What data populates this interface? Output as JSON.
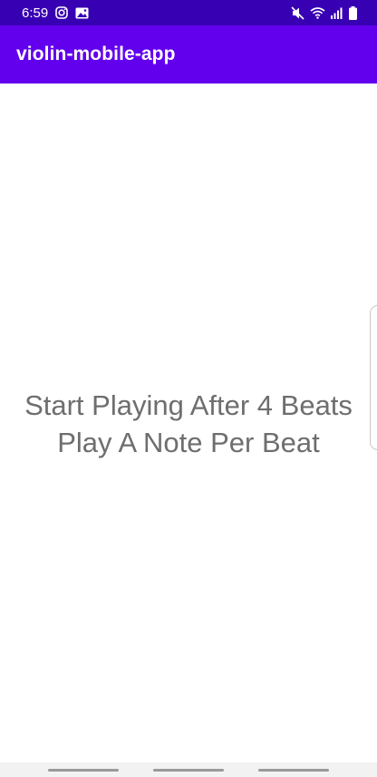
{
  "status_bar": {
    "time": "6:59",
    "left_icons": [
      "instagram-icon",
      "gallery-icon"
    ],
    "right_icons": [
      "mute-icon",
      "wifi-icon",
      "signal-icon",
      "battery-icon"
    ],
    "background": "#3700b3"
  },
  "app_bar": {
    "title": "violin-mobile-app",
    "background": "#6200ee"
  },
  "main": {
    "line1": "Start Playing After 4 Beats",
    "line2": "Play A Note Per Beat",
    "text_color": "#6e6e6e"
  },
  "nav_bar": {
    "buttons": [
      "recents-button",
      "home-button",
      "back-button"
    ]
  }
}
